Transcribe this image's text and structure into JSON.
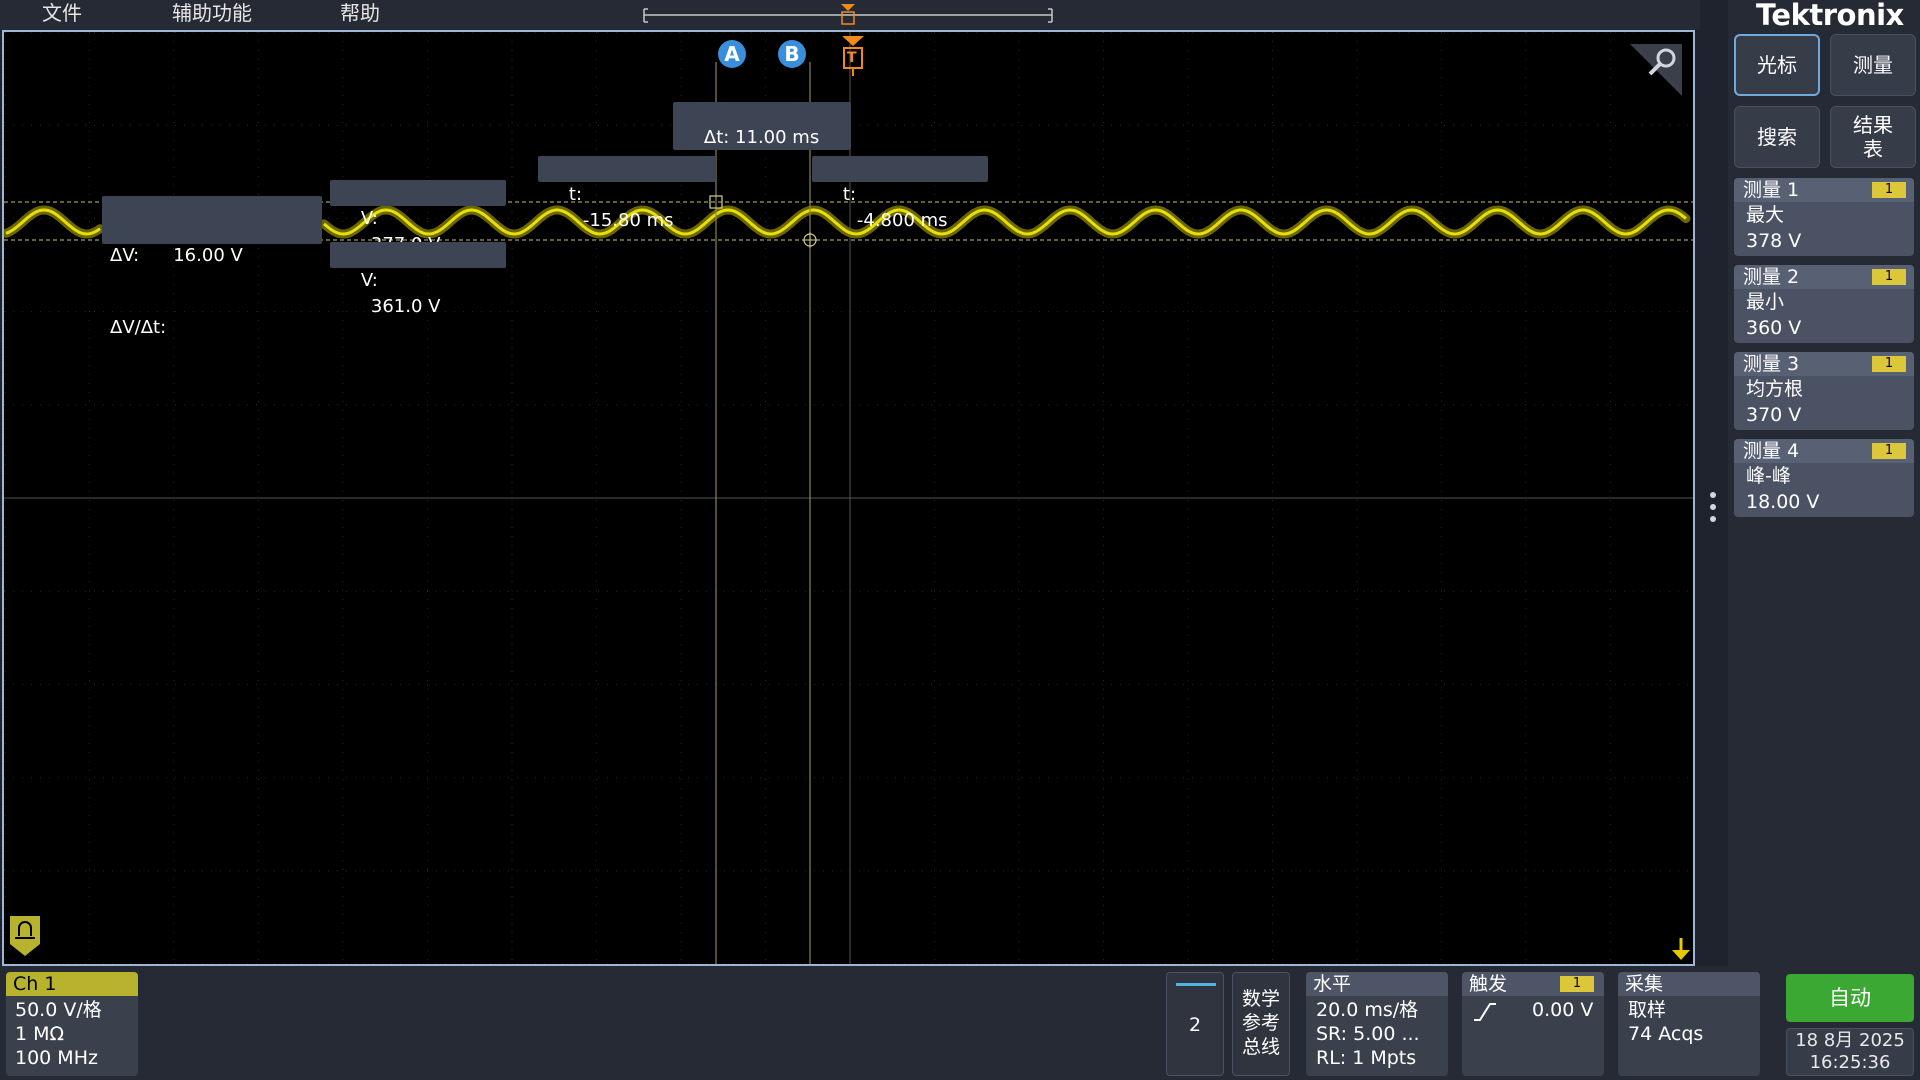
{
  "menu": {
    "file": "文件",
    "utility": "辅助功能",
    "help": "帮助"
  },
  "brand": "Tektronix",
  "cursor": {
    "a_label": "A",
    "b_label": "B",
    "trigger_label": "T",
    "delta_t": "Δt: 11.00 ms",
    "a_t_label": "t:",
    "a_t_value": "-15.80 ms",
    "b_t_label": "t:",
    "b_t_value": "-4.800 ms",
    "v_upper_label": "V:",
    "v_upper_value": "377.0 V",
    "v_lower_label": "V:",
    "v_lower_value": "361.0 V",
    "delta_v_label": "ΔV:",
    "delta_v_value": "16.00 V",
    "delta_v_dt_label": "ΔV/Δt:"
  },
  "buttons": {
    "cursor": "光标",
    "measure": "测量",
    "search": "搜索",
    "results_line1": "结果",
    "results_line2": "表"
  },
  "measurements": [
    {
      "title": "测量 1",
      "channel": "1",
      "name": "最大",
      "value": "378 V"
    },
    {
      "title": "测量 2",
      "channel": "1",
      "name": "最小",
      "value": "360 V"
    },
    {
      "title": "测量 3",
      "channel": "1",
      "name": "均方根",
      "value": "370 V"
    },
    {
      "title": "测量 4",
      "channel": "1",
      "name": "峰-峰",
      "value": "18.00 V"
    }
  ],
  "channel1": {
    "title": "Ch 1",
    "scale": "50.0 V/格",
    "impedance": "1 MΩ",
    "bandwidth": "100 MHz",
    "color": "#b8b32e"
  },
  "add_channel": {
    "label": "2"
  },
  "math_ref_bus": {
    "line1": "数学",
    "line2": "参考",
    "line3": "总线"
  },
  "horizontal": {
    "title": "水平",
    "scale": "20.0 ms/格",
    "sample_rate": "SR: 5.00 ...",
    "record_length": "RL: 1 Mpts"
  },
  "trigger": {
    "title": "触发",
    "channel": "1",
    "level": "0.00 V"
  },
  "acquisition": {
    "title": "采集",
    "mode": "取样",
    "count": "74 Acqs"
  },
  "run_mode": {
    "label": "自动",
    "color": "#3aa832"
  },
  "datetime": {
    "date": "18 8月 2025",
    "time": "16:25:36"
  },
  "colors": {
    "waveform": "#e8e000",
    "cursor_line": "#c8c070",
    "trigger": "#f08a1e",
    "cursor_badge": "#3a8fdc"
  }
}
